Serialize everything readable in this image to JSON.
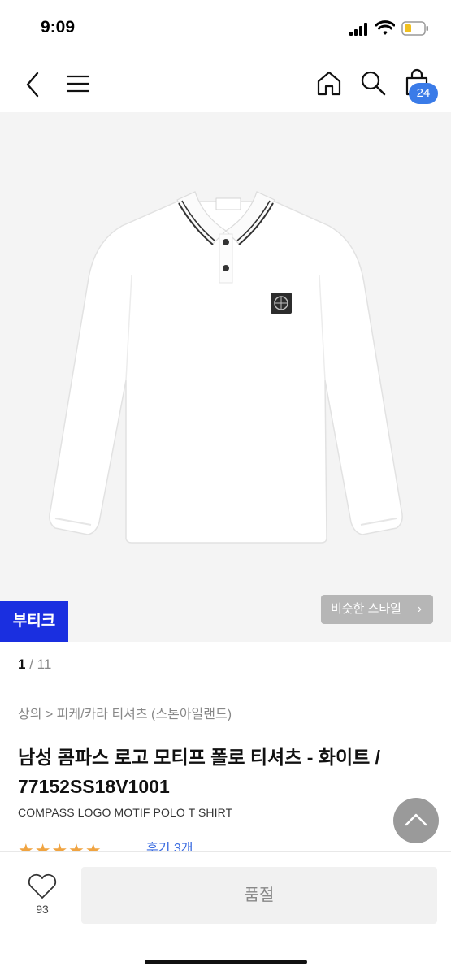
{
  "status": {
    "time": "9:09"
  },
  "nav": {
    "cart_count": "24"
  },
  "image": {
    "boutique_label": "부티크",
    "similar_label": "비슷한 스타일",
    "similar_chevron": "›"
  },
  "pager": {
    "current": "1",
    "separator": " / ",
    "total": "11"
  },
  "category": "상의 > 피케/카라 티셔츠 (스톤아일랜드)",
  "product": {
    "title": "남성 콤파스 로고 모티프 폴로 티셔츠 - 화이트 / 77152SS18V1001",
    "subtitle": "COMPASS LOGO MOTIF POLO T SHIRT",
    "stars": "★★★★★",
    "review_link": "후기 3개",
    "rating": 5
  },
  "bottom": {
    "like_count": "93",
    "buy_label": "품절"
  },
  "colors": {
    "accent": "#3a7be8",
    "boutique": "#1a2fe0",
    "star": "#f0a441"
  }
}
